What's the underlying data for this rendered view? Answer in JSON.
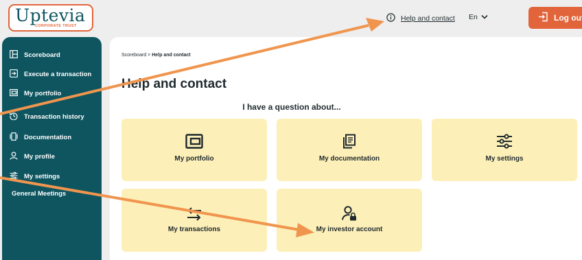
{
  "brand": {
    "name": "Uptevia",
    "tagline": "CORPORATE TRUST"
  },
  "header": {
    "help_label": "Help and contact",
    "language": "En",
    "logout_label": "Log out"
  },
  "sidebar": {
    "items": [
      {
        "label": "Scoreboard",
        "icon": "scoreboard-icon"
      },
      {
        "label": "Execute a transaction",
        "icon": "execute-transaction-icon"
      },
      {
        "label": "My portfolio",
        "icon": "wallet-icon"
      },
      {
        "label": "Transaction history",
        "icon": "history-icon"
      },
      {
        "label": "Documentation",
        "icon": "documentation-icon"
      },
      {
        "label": "My profile",
        "icon": "user-icon"
      },
      {
        "label": "My settings",
        "icon": "settings-sliders-icon"
      },
      {
        "label": "General Meetings",
        "icon": ""
      }
    ]
  },
  "main": {
    "breadcrumb": {
      "root": "Scoreboard",
      "separator": ">",
      "current": "Help and contact"
    },
    "title": "Help and contact",
    "subheading": "I have a question about...",
    "cards": [
      {
        "label": "My portfolio",
        "icon": "wallet-icon"
      },
      {
        "label": "My documentation",
        "icon": "documentation-icon"
      },
      {
        "label": "My settings",
        "icon": "settings-sliders-icon"
      },
      {
        "label": "My transactions",
        "icon": "transfer-arrows-icon"
      },
      {
        "label": "My investor account",
        "icon": "user-lock-icon"
      }
    ]
  },
  "colors": {
    "brand_teal": "#0e5560",
    "accent_orange": "#e2643a",
    "card_yellow": "#fdefb8",
    "annotation_arrow": "#f0954e"
  }
}
